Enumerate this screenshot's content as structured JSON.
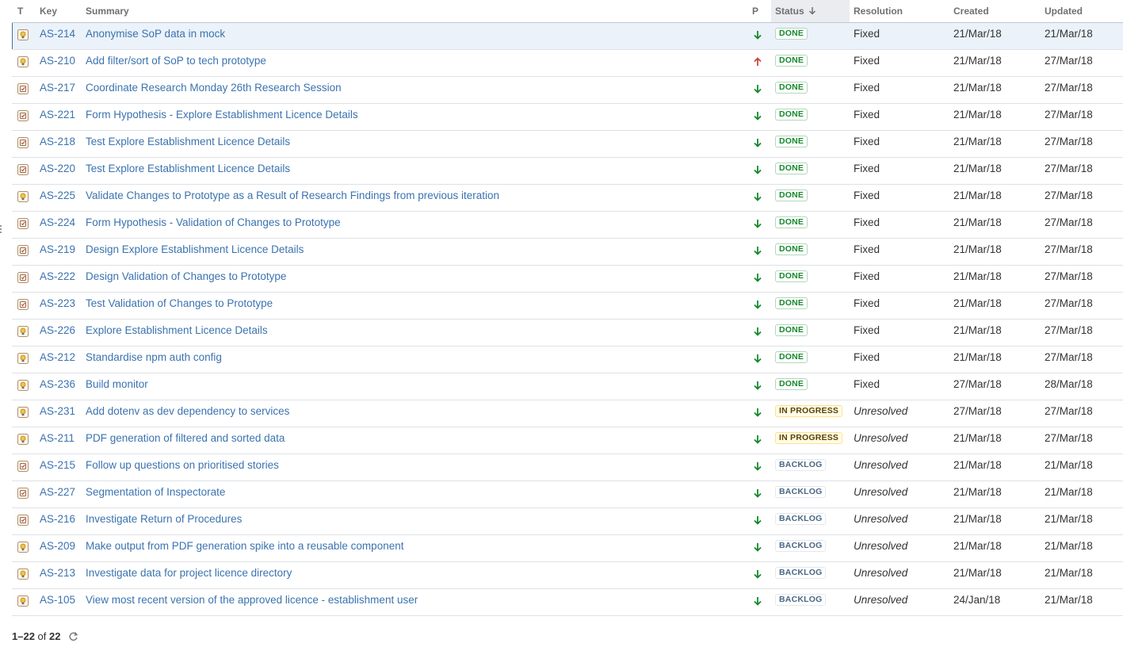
{
  "table": {
    "columns": {
      "type": "T",
      "key": "Key",
      "summary": "Summary",
      "priority": "P",
      "status": "Status",
      "resolution": "Resolution",
      "created": "Created",
      "updated": "Updated"
    },
    "sorted_column": "status",
    "sort_direction": "descending",
    "rows": [
      {
        "type": "improvement",
        "key": "AS-214",
        "summary": "Anonymise SoP data in mock",
        "priority": "low",
        "status": "DONE",
        "resolution": "Fixed",
        "created": "21/Mar/18",
        "updated": "21/Mar/18"
      },
      {
        "type": "improvement",
        "key": "AS-210",
        "summary": "Add filter/sort of SoP to tech prototype",
        "priority": "high",
        "status": "DONE",
        "resolution": "Fixed",
        "created": "21/Mar/18",
        "updated": "27/Mar/18"
      },
      {
        "type": "task",
        "key": "AS-217",
        "summary": "Coordinate Research Monday 26th Research Session",
        "priority": "low",
        "status": "DONE",
        "resolution": "Fixed",
        "created": "21/Mar/18",
        "updated": "27/Mar/18"
      },
      {
        "type": "task",
        "key": "AS-221",
        "summary": "Form Hypothesis - Explore Establishment Licence Details",
        "priority": "low",
        "status": "DONE",
        "resolution": "Fixed",
        "created": "21/Mar/18",
        "updated": "27/Mar/18"
      },
      {
        "type": "task",
        "key": "AS-218",
        "summary": "Test Explore Establishment Licence Details",
        "priority": "low",
        "status": "DONE",
        "resolution": "Fixed",
        "created": "21/Mar/18",
        "updated": "27/Mar/18"
      },
      {
        "type": "task",
        "key": "AS-220",
        "summary": "Test Explore Establishment Licence Details",
        "priority": "low",
        "status": "DONE",
        "resolution": "Fixed",
        "created": "21/Mar/18",
        "updated": "27/Mar/18"
      },
      {
        "type": "improvement",
        "key": "AS-225",
        "summary": "Validate Changes to Prototype as a Result of Research Findings from previous iteration",
        "priority": "low",
        "status": "DONE",
        "resolution": "Fixed",
        "created": "21/Mar/18",
        "updated": "27/Mar/18"
      },
      {
        "type": "task",
        "key": "AS-224",
        "summary": "Form Hypothesis - Validation of Changes to Prototype",
        "priority": "low",
        "status": "DONE",
        "resolution": "Fixed",
        "created": "21/Mar/18",
        "updated": "27/Mar/18"
      },
      {
        "type": "task",
        "key": "AS-219",
        "summary": "Design Explore Establishment Licence Details",
        "priority": "low",
        "status": "DONE",
        "resolution": "Fixed",
        "created": "21/Mar/18",
        "updated": "27/Mar/18"
      },
      {
        "type": "task",
        "key": "AS-222",
        "summary": "Design Validation of Changes to Prototype",
        "priority": "low",
        "status": "DONE",
        "resolution": "Fixed",
        "created": "21/Mar/18",
        "updated": "27/Mar/18"
      },
      {
        "type": "task",
        "key": "AS-223",
        "summary": "Test Validation of Changes to Prototype",
        "priority": "low",
        "status": "DONE",
        "resolution": "Fixed",
        "created": "21/Mar/18",
        "updated": "27/Mar/18"
      },
      {
        "type": "improvement",
        "key": "AS-226",
        "summary": "Explore Establishment Licence Details",
        "priority": "low",
        "status": "DONE",
        "resolution": "Fixed",
        "created": "21/Mar/18",
        "updated": "27/Mar/18"
      },
      {
        "type": "improvement",
        "key": "AS-212",
        "summary": "Standardise npm auth config",
        "priority": "low",
        "status": "DONE",
        "resolution": "Fixed",
        "created": "21/Mar/18",
        "updated": "27/Mar/18"
      },
      {
        "type": "improvement",
        "key": "AS-236",
        "summary": "Build monitor",
        "priority": "low",
        "status": "DONE",
        "resolution": "Fixed",
        "created": "27/Mar/18",
        "updated": "28/Mar/18"
      },
      {
        "type": "improvement",
        "key": "AS-231",
        "summary": "Add dotenv as dev dependency to services",
        "priority": "low",
        "status": "IN PROGRESS",
        "resolution": "Unresolved",
        "created": "27/Mar/18",
        "updated": "27/Mar/18"
      },
      {
        "type": "improvement",
        "key": "AS-211",
        "summary": "PDF generation of filtered and sorted data",
        "priority": "low",
        "status": "IN PROGRESS",
        "resolution": "Unresolved",
        "created": "21/Mar/18",
        "updated": "27/Mar/18"
      },
      {
        "type": "task",
        "key": "AS-215",
        "summary": "Follow up questions on prioritised stories",
        "priority": "low",
        "status": "BACKLOG",
        "resolution": "Unresolved",
        "created": "21/Mar/18",
        "updated": "21/Mar/18"
      },
      {
        "type": "task",
        "key": "AS-227",
        "summary": "Segmentation of Inspectorate",
        "priority": "low",
        "status": "BACKLOG",
        "resolution": "Unresolved",
        "created": "21/Mar/18",
        "updated": "21/Mar/18"
      },
      {
        "type": "task",
        "key": "AS-216",
        "summary": "Investigate Return of Procedures",
        "priority": "low",
        "status": "BACKLOG",
        "resolution": "Unresolved",
        "created": "21/Mar/18",
        "updated": "21/Mar/18"
      },
      {
        "type": "improvement",
        "key": "AS-209",
        "summary": "Make output from PDF generation spike into a reusable component",
        "priority": "low",
        "status": "BACKLOG",
        "resolution": "Unresolved",
        "created": "21/Mar/18",
        "updated": "21/Mar/18"
      },
      {
        "type": "improvement",
        "key": "AS-213",
        "summary": "Investigate data for project licence directory",
        "priority": "low",
        "status": "BACKLOG",
        "resolution": "Unresolved",
        "created": "21/Mar/18",
        "updated": "21/Mar/18"
      },
      {
        "type": "improvement",
        "key": "AS-105",
        "summary": "View most recent version of the approved licence - establishment user",
        "priority": "low",
        "status": "BACKLOG",
        "resolution": "Unresolved",
        "created": "24/Jan/18",
        "updated": "21/Mar/18"
      }
    ]
  },
  "pagination": {
    "range": "1–22",
    "of_label": "of",
    "total": "22"
  },
  "colors": {
    "link": "#3b73af",
    "priority_low": "#14892c",
    "priority_high": "#d04437",
    "done": "#14892c",
    "in_progress": "#594300",
    "backlog": "#4a6785"
  }
}
